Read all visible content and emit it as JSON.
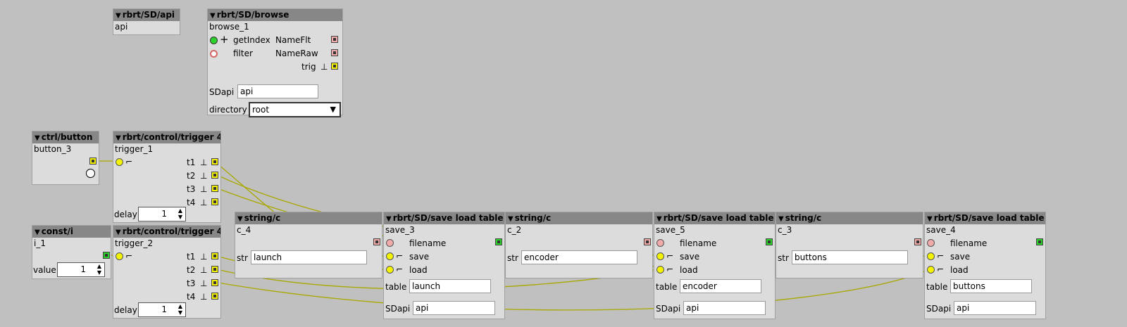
{
  "objects": {
    "sd_api": {
      "type": "rbrt/SD/api",
      "name": "api"
    },
    "sd_browse": {
      "type": "rbrt/SD/browse",
      "name": "browse_1",
      "inlets": [
        "getIndex",
        "filter"
      ],
      "outlets": [
        "NameFlt",
        "NameRaw",
        "trig"
      ],
      "sdapi_label": "SDapi",
      "sdapi_value": "api",
      "directory_label": "directory",
      "directory_value": "root"
    },
    "button": {
      "type": "ctrl/button",
      "name": "button_3"
    },
    "trigger1": {
      "type": "rbrt/control/trigger 4",
      "name": "trigger_1",
      "outlets": [
        "t1",
        "t2",
        "t3",
        "t4"
      ],
      "delay_label": "delay",
      "delay_value": "1"
    },
    "const_i": {
      "type": "const/i",
      "name": "i_1",
      "value_label": "value",
      "value": "1"
    },
    "trigger2": {
      "type": "rbrt/control/trigger 4",
      "name": "trigger_2",
      "outlets": [
        "t1",
        "t2",
        "t3",
        "t4"
      ],
      "delay_label": "delay",
      "delay_value": "1"
    },
    "string_c4": {
      "type": "string/c",
      "name": "c_4",
      "str_label": "str",
      "str_value": "launch"
    },
    "save3": {
      "type": "rbrt/SD/save load table",
      "name": "save_3",
      "filename": "filename",
      "save": "save",
      "load": "load",
      "table_label": "table",
      "table_value": "launch",
      "sdapi_label": "SDapi",
      "sdapi_value": "api"
    },
    "string_c2": {
      "type": "string/c",
      "name": "c_2",
      "str_label": "str",
      "str_value": "encoder"
    },
    "save5": {
      "type": "rbrt/SD/save load table",
      "name": "save_5",
      "filename": "filename",
      "save": "save",
      "load": "load",
      "table_label": "table",
      "table_value": "encoder",
      "sdapi_label": "SDapi",
      "sdapi_value": "api"
    },
    "string_c3": {
      "type": "string/c",
      "name": "c_3",
      "str_label": "str",
      "str_value": "buttons"
    },
    "save4": {
      "type": "rbrt/SD/save load table",
      "name": "save_4",
      "filename": "filename",
      "save": "save",
      "load": "load",
      "table_label": "table",
      "table_value": "buttons",
      "sdapi_label": "SDapi",
      "sdapi_value": "api"
    }
  },
  "colors": {
    "background": "#c0c0c0",
    "object_body": "#dcdcdc",
    "object_header": "#878787",
    "wire": "#a8a800",
    "bool_port": "#f4f400",
    "string_port": "#f0aaaa",
    "int_port": "#2cd12c"
  }
}
